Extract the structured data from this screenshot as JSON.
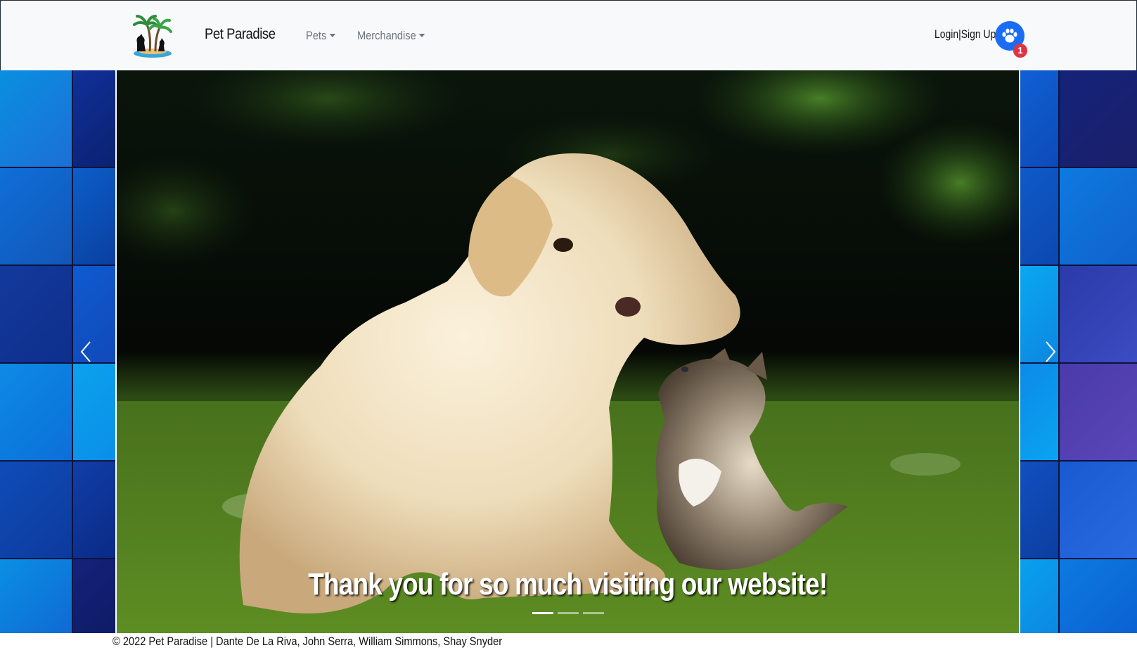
{
  "navbar": {
    "brand": "Pet Paradise",
    "menus": [
      {
        "label": "Pets"
      },
      {
        "label": "Merchandise"
      }
    ],
    "login_label": "Login",
    "separator": "|",
    "signup_label": "Sign Up",
    "cart_badge_count": "1",
    "paw_icon": "paw-icon",
    "accent_color": "#1a6cf5",
    "badge_color": "#dc3545"
  },
  "carousel": {
    "caption": "Thank you for so much visiting our website!",
    "slide_count": 3,
    "active_slide": 1,
    "prev_icon": "chevron-left-icon",
    "next_icon": "chevron-right-icon"
  },
  "footer": {
    "text": "© 2022 Pet Paradise | Dante De La Riva, John Serra, William Simmons, Shay Snyder"
  }
}
